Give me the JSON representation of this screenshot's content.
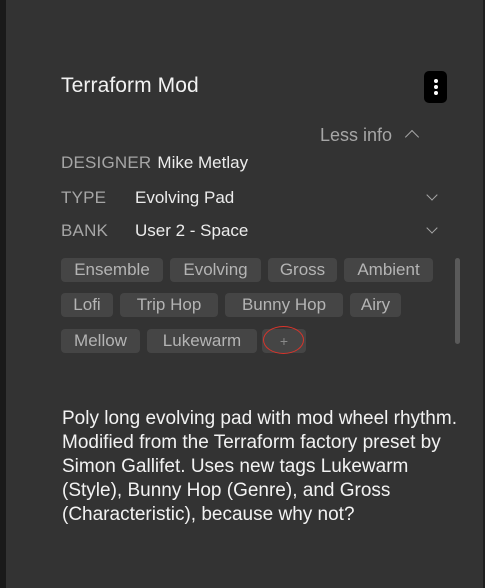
{
  "preset": {
    "name": "Terraform Mod",
    "less_info_label": "Less info"
  },
  "info": {
    "designer": {
      "label": "DESIGNER",
      "value": "Mike Metlay"
    },
    "type": {
      "label": "TYPE",
      "value": "Evolving Pad"
    },
    "bank": {
      "label": "BANK",
      "value": "User 2 - Space"
    }
  },
  "tags": [
    "Ensemble",
    "Evolving",
    "Gross",
    "Ambient",
    "Lofi",
    "Trip Hop",
    "Bunny Hop",
    "Airy",
    "Mellow",
    "Lukewarm"
  ],
  "add_tag_label": "+",
  "description": "Poly long evolving pad with mod wheel rhythm. Modified from the Terraform factory preset by Simon Gallifet. Uses new tags Lukewarm (Style), Bunny Hop (Genre), and Gross (Characteristic), because why not?",
  "colors": {
    "panel": "#333333",
    "tag_bg": "#454545",
    "highlight_ring": "#d9342b"
  },
  "icons": {
    "menu": "kebab-menu-icon",
    "collapse": "chevron-up-icon",
    "dropdown": "chevron-down-icon"
  }
}
